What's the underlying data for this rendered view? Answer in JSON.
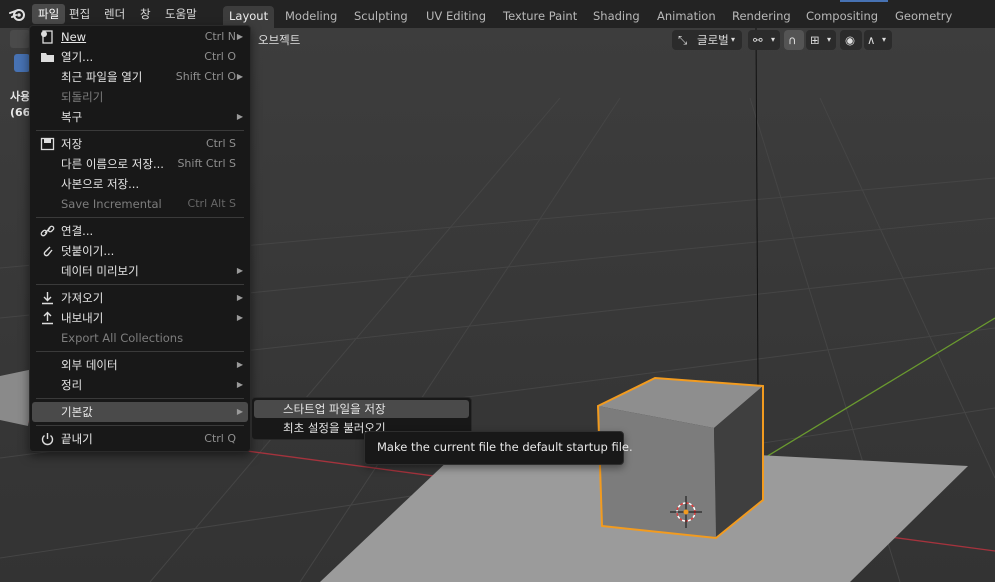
{
  "topbar": {
    "menus": [
      "파일",
      "편집",
      "렌더",
      "창",
      "도움말"
    ],
    "workspaces": [
      "Layout",
      "Modeling",
      "Sculpting",
      "UV Editing",
      "Texture Paint",
      "Shading",
      "Animation",
      "Rendering",
      "Compositing",
      "Geometry Nodes"
    ],
    "active_workspace": "Layout"
  },
  "viewport": {
    "mode_label": "오브젝트",
    "orientation_label": "글로벌",
    "overlay_text_1": "사용",
    "overlay_text_2": "(66"
  },
  "file_menu": {
    "items": [
      {
        "label": "New",
        "shortcut": "Ctrl N",
        "icon": "new-file-icon",
        "submenu": true
      },
      {
        "label": "열기...",
        "shortcut": "Ctrl O",
        "icon": "folder-icon"
      },
      {
        "label": "최근 파일을 열기",
        "shortcut": "Shift Ctrl O",
        "submenu": true
      },
      {
        "label": "되돌리기",
        "disabled": true
      },
      {
        "label": "복구",
        "submenu": true
      },
      {
        "label": "저장",
        "shortcut": "Ctrl S",
        "icon": "save-icon"
      },
      {
        "label": "다른 이름으로 저장...",
        "shortcut": "Shift Ctrl S"
      },
      {
        "label": "사본으로 저장..."
      },
      {
        "label": "Save Incremental",
        "shortcut": "Ctrl Alt S",
        "disabled": true
      },
      {
        "label": "연결...",
        "icon": "link-icon"
      },
      {
        "label": "덧붙이기...",
        "icon": "append-icon"
      },
      {
        "label": "데이터 미리보기",
        "submenu": true
      },
      {
        "label": "가져오기",
        "icon": "import-icon",
        "submenu": true
      },
      {
        "label": "내보내기",
        "icon": "export-icon",
        "submenu": true
      },
      {
        "label": "Export All Collections",
        "disabled": true
      },
      {
        "label": "외부 데이터",
        "submenu": true
      },
      {
        "label": "정리",
        "submenu": true
      },
      {
        "label": "기본값",
        "submenu": true,
        "highlighted": true
      },
      {
        "label": "끝내기",
        "shortcut": "Ctrl Q",
        "icon": "power-icon"
      }
    ]
  },
  "defaults_submenu": {
    "items": [
      "스타트업 파일을 저장",
      "최초 설정을 불러오기"
    ]
  },
  "tooltip": {
    "text": "Make the current file the default startup file."
  },
  "colors": {
    "accent": "#4772b3",
    "selection_outline": "#f29b1f",
    "menu_bg": "#181818",
    "x_axis": "#a5333d",
    "y_axis": "#6a9a2f"
  }
}
